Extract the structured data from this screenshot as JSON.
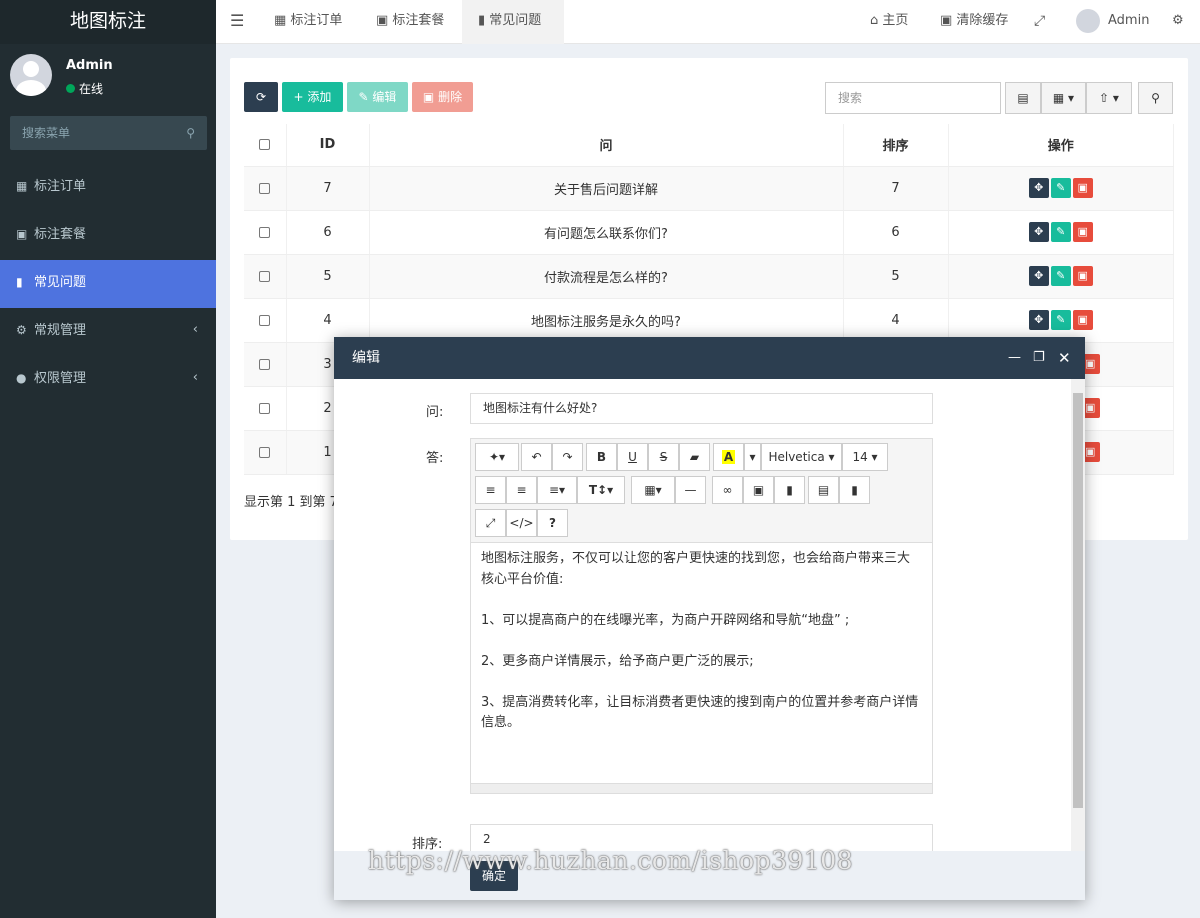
{
  "sidebar": {
    "logo": "地图标注",
    "user_name": "Admin",
    "user_status": "在线",
    "search_placeholder": "搜索菜单",
    "items": [
      {
        "label": "标注订单",
        "icon": "map-icon"
      },
      {
        "label": "标注套餐",
        "icon": "sitemap-icon"
      },
      {
        "label": "常见问题",
        "icon": "book-icon",
        "active": true
      },
      {
        "label": "常规管理",
        "icon": "cogs-icon",
        "arrow": "‹"
      },
      {
        "label": "权限管理",
        "icon": "users-icon",
        "arrow": "‹"
      }
    ]
  },
  "topbar": {
    "tabs": [
      "标注订单",
      "标注套餐",
      "常见问题"
    ],
    "home": "主页",
    "clear_cache": "清除缓存",
    "admin": "Admin"
  },
  "toolbar": {
    "add": "添加",
    "edit": "编辑",
    "delete": "删除",
    "search_placeholder": "搜索"
  },
  "table": {
    "headers": [
      "ID",
      "问",
      "排序",
      "操作"
    ],
    "rows": [
      {
        "id": "7",
        "q": "关于售后问题详解",
        "sort": "7"
      },
      {
        "id": "6",
        "q": "有问题怎么联系你们?",
        "sort": "6"
      },
      {
        "id": "5",
        "q": "付款流程是怎么样的?",
        "sort": "5"
      },
      {
        "id": "4",
        "q": "地图标注服务是永久的吗?",
        "sort": "4"
      },
      {
        "id": "3",
        "q": "",
        "sort": ""
      },
      {
        "id": "2",
        "q": "",
        "sort": ""
      },
      {
        "id": "1",
        "q": "",
        "sort": ""
      }
    ],
    "pagination": "显示第 1 到第 7"
  },
  "modal": {
    "title": "编辑",
    "q_label": "问:",
    "q_value": "地图标注有什么好处?",
    "a_label": "答:",
    "font_name": "Helvetica",
    "font_size": "14",
    "content": [
      "地图标注服务，不仅可以让您的客户更快速的找到您，也会给商户带来三大核心平台价值:",
      "",
      "1、可以提高商户的在线曝光率，为商户开辟网络和导航“地盘” ;",
      "",
      "2、更多商户详情展示，给予商户更广泛的展示;",
      "",
      "3、提高消费转化率，让目标消费者更快速的搜到南户的位置并参考商户详情信息。"
    ],
    "sort_label": "排序:",
    "sort_value": "2",
    "ok": "确定"
  },
  "watermark": "https://www.huzhan.com/ishop39108",
  "colors": {
    "sidebar": "#222d32",
    "active": "#4e73df",
    "header": "#2c3e50",
    "green": "#18bc9c",
    "red": "#e74c3c"
  }
}
